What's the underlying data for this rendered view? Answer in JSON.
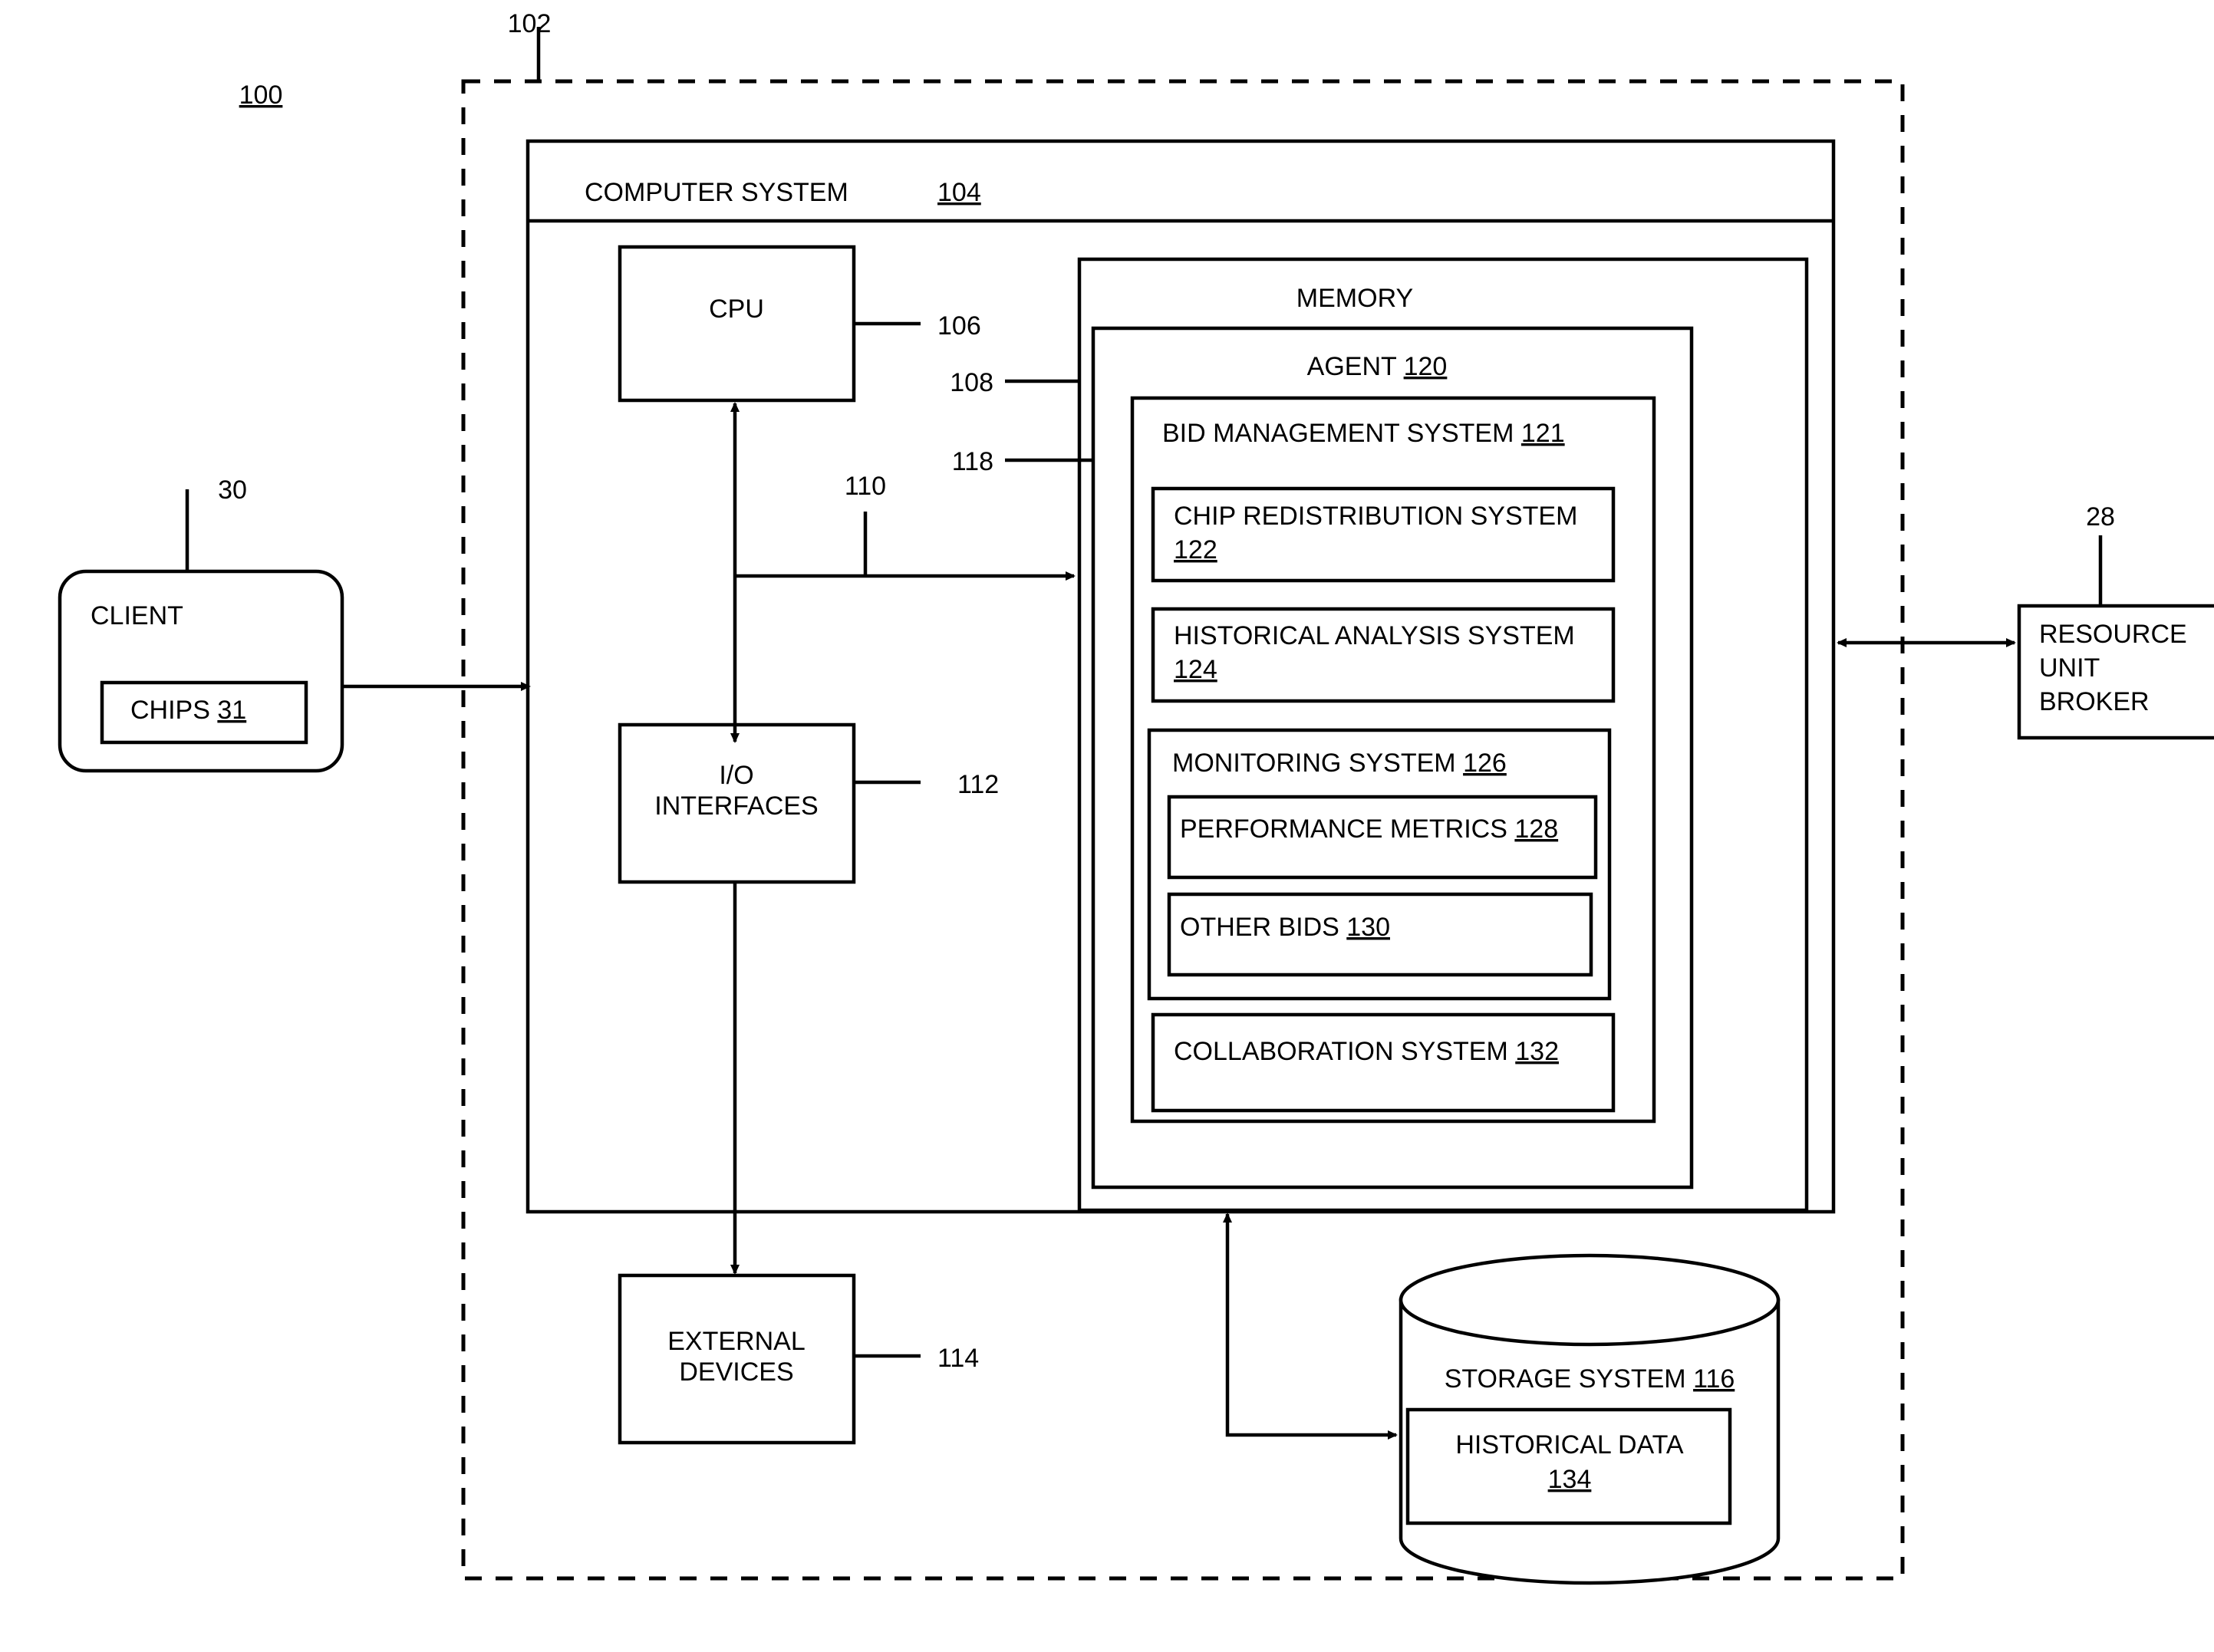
{
  "figure": {
    "system_ref": "100",
    "environment_ref": "102"
  },
  "nodes": {
    "client": {
      "label": "CLIENT",
      "ref": "30",
      "chips_label": "CHIPS",
      "chips_ref": "31"
    },
    "computer_system": {
      "label": "COMPUTER SYSTEM",
      "ref": "104"
    },
    "cpu": {
      "label": "CPU",
      "ref": "106"
    },
    "bus": {
      "ref": "110"
    },
    "io_interfaces": {
      "line1": "I/O",
      "line2": "INTERFACES",
      "ref": "112"
    },
    "external_devices": {
      "line1": "EXTERNAL",
      "line2": "DEVICES",
      "ref": "114"
    },
    "memory": {
      "label": "MEMORY",
      "ref": "108"
    },
    "agent": {
      "label": "AGENT",
      "ref": "120",
      "pointer_ref": "118"
    },
    "bid_management_system": {
      "label": "BID MANAGEMENT SYSTEM",
      "ref": "121"
    },
    "chip_redistribution_system": {
      "label": "CHIP REDISTRIBUTION SYSTEM",
      "ref": "122"
    },
    "historical_analysis_system": {
      "label": "HISTORICAL ANALYSIS SYSTEM",
      "ref": "124"
    },
    "monitoring_system": {
      "label": "MONITORING SYSTEM",
      "ref": "126"
    },
    "performance_metrics": {
      "label": "PERFORMANCE METRICS",
      "ref": "128"
    },
    "other_bids": {
      "label": "OTHER BIDS",
      "ref": "130"
    },
    "collaboration_system": {
      "label": "COLLABORATION SYSTEM",
      "ref": "132"
    },
    "storage_system": {
      "label": "STORAGE SYSTEM",
      "ref": "116"
    },
    "historical_data": {
      "label": "HISTORICAL DATA",
      "ref": "134"
    },
    "resource_unit_broker": {
      "line1": "RESOURCE",
      "line2": "UNIT",
      "line3": "BROKER",
      "ref": "28"
    }
  },
  "colors": {
    "stroke": "#000000",
    "background": "#ffffff"
  }
}
